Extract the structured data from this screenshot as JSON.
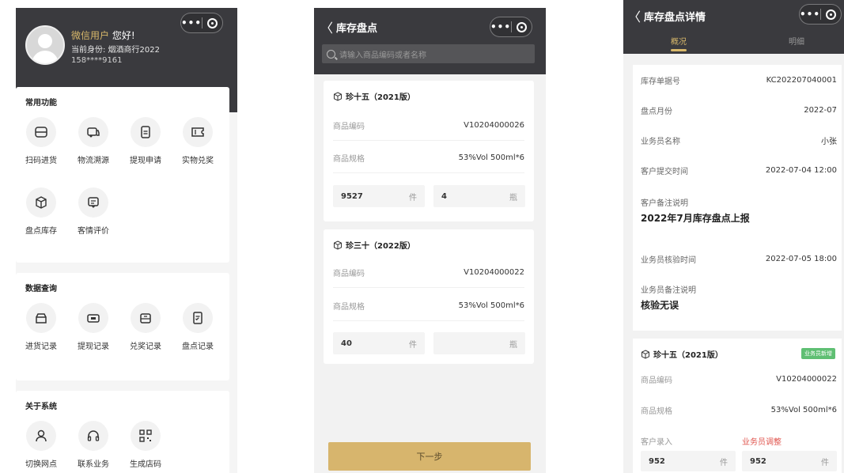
{
  "screen1": {
    "user": {
      "nickname": "微信用户",
      "greeting": "您好!",
      "role": "当前身份: 烟酒商行2022",
      "phone": "158****9161"
    },
    "sections": [
      {
        "title": "常用功能",
        "items": [
          {
            "label": "扫码进货",
            "icon": "scan-icon"
          },
          {
            "label": "物流溯源",
            "icon": "truck-icon"
          },
          {
            "label": "提现申请",
            "icon": "document-icon"
          },
          {
            "label": "实物兑奖",
            "icon": "ticket-icon"
          },
          {
            "label": "盘点库存",
            "icon": "box-icon"
          },
          {
            "label": "客情评价",
            "icon": "message-icon"
          }
        ]
      },
      {
        "title": "数据查询",
        "items": [
          {
            "label": "进货记录",
            "icon": "package-icon"
          },
          {
            "label": "提现记录",
            "icon": "card-icon"
          },
          {
            "label": "兑奖记录",
            "icon": "gift-icon"
          },
          {
            "label": "盘点记录",
            "icon": "checklist-icon"
          }
        ]
      },
      {
        "title": "关于系统",
        "items": [
          {
            "label": "切换网点",
            "icon": "user-icon"
          },
          {
            "label": "联系业务",
            "icon": "headset-icon"
          },
          {
            "label": "生成店码",
            "icon": "qrcode-icon"
          }
        ]
      }
    ]
  },
  "screen2": {
    "title": "库存盘点",
    "search_placeholder": "请输入商品编码或者名称",
    "products": [
      {
        "name": "珍十五（2021版）",
        "code_label": "商品编码",
        "code": "V10204000026",
        "spec_label": "商品规格",
        "spec": "53%Vol 500ml*6",
        "qty_piece": "9527",
        "unit_piece": "件",
        "qty_bottle": "4",
        "unit_bottle": "瓶"
      },
      {
        "name": "珍三十（2022版）",
        "code_label": "商品编码",
        "code": "V10204000022",
        "spec_label": "商品规格",
        "spec": "53%Vol 500ml*6",
        "qty_piece": "40",
        "unit_piece": "件",
        "qty_bottle": "",
        "unit_bottle": "瓶"
      }
    ],
    "next_button": "下一步"
  },
  "screen3": {
    "title": "库存盘点详情",
    "tabs": [
      "概况",
      "明细"
    ],
    "details": [
      {
        "label": "库存单据号",
        "value": "KC202207040001"
      },
      {
        "label": "盘点月份",
        "value": "2022-07"
      },
      {
        "label": "业务员名称",
        "value": "小张"
      },
      {
        "label": "客户提交时间",
        "value": "2022-07-04 12:00"
      }
    ],
    "customer_note_label": "客户备注说明",
    "customer_note": "2022年7月库存盘点上报",
    "verify_time_label": "业务员核验时间",
    "verify_time": "2022-07-05 18:00",
    "staff_note_label": "业务员备注说明",
    "staff_note": "核验无误",
    "product": {
      "name": "珍十五（2021版）",
      "tag": "业务员新增",
      "code_label": "商品编码",
      "code": "V10204000022",
      "spec_label": "商品规格",
      "spec": "53%Vol 500ml*6",
      "customer_entry_label": "客户录入",
      "staff_adjust_label": "业务员调整",
      "customer_qty": "952",
      "customer_unit": "件",
      "staff_qty": "952",
      "staff_unit": "件"
    }
  },
  "colors": {
    "header": "#3a3a3e",
    "accent": "#d8b86a",
    "button": "#d7b56d",
    "tag": "#5fbf73",
    "adjust": "#e0564f"
  }
}
